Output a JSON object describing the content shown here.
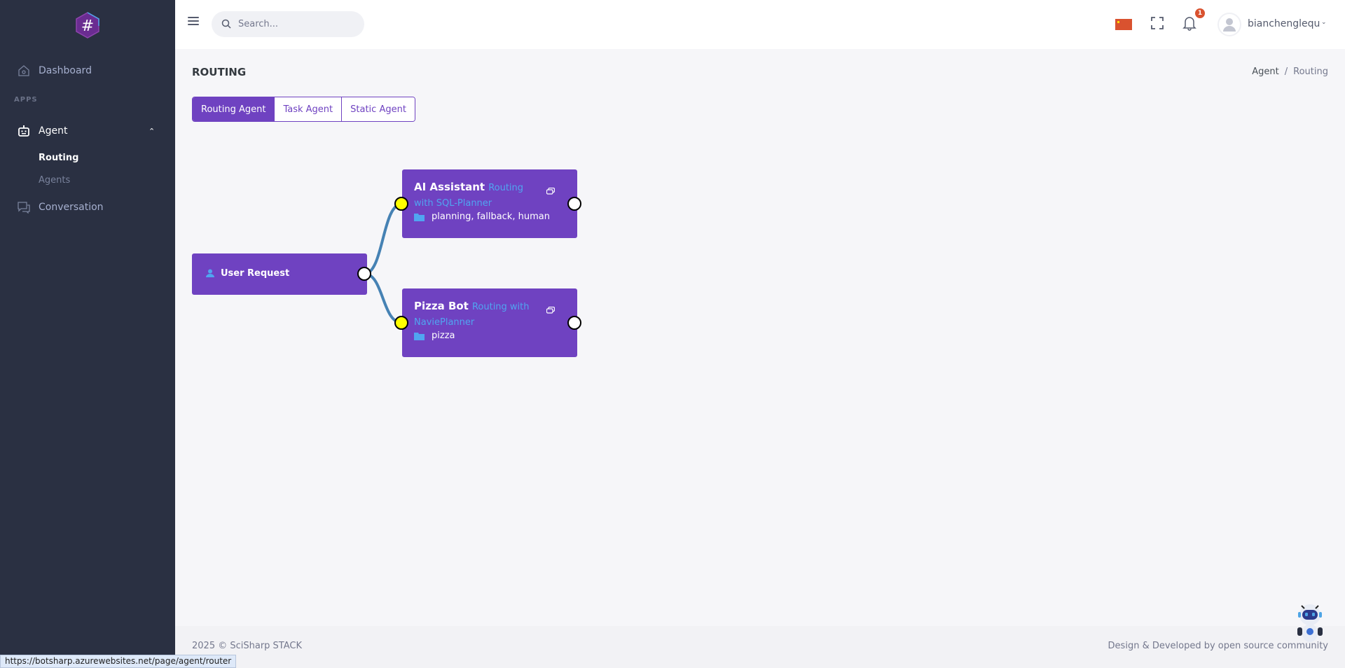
{
  "sidebar": {
    "logo_icon": "hash-hexagon-logo",
    "items": [
      {
        "label": "Dashboard",
        "icon": "home-icon"
      },
      {
        "label": "Agent",
        "icon": "robot-icon"
      },
      {
        "label": "Conversation",
        "icon": "chat-icon"
      }
    ],
    "section_label": "APPS",
    "agent_submenu": [
      {
        "label": "Routing",
        "active": true
      },
      {
        "label": "Agents",
        "active": false
      }
    ]
  },
  "header": {
    "search_placeholder": "Search...",
    "language_flag": "china-flag",
    "notification_count": "1",
    "username": "bianchenglequ"
  },
  "page": {
    "title": "ROUTING",
    "breadcrumb": [
      "Agent",
      "Routing"
    ],
    "tabs": [
      {
        "label": "Routing Agent",
        "active": true
      },
      {
        "label": "Task Agent",
        "active": false
      },
      {
        "label": "Static Agent",
        "active": false
      }
    ]
  },
  "flow": {
    "source": {
      "label": "User Request",
      "icon": "user-icon"
    },
    "agents": [
      {
        "name": "AI Assistant",
        "description": "Routing with SQL-Planner",
        "profiles": "planning, fallback, human"
      },
      {
        "name": "Pizza Bot",
        "description": "Routing with NaviePlanner",
        "profiles": "pizza"
      }
    ],
    "colors": {
      "node": "#6f42c1",
      "edge": "#4682b4",
      "input_port": "#ffff00",
      "output_port": "#ffffff"
    }
  },
  "footer": {
    "copyright": "2025 © SciSharp STACK",
    "credit": "Design & Developed by open source community"
  },
  "status_bar": {
    "url": "https://botsharp.azurewebsites.net/page/agent/router"
  }
}
